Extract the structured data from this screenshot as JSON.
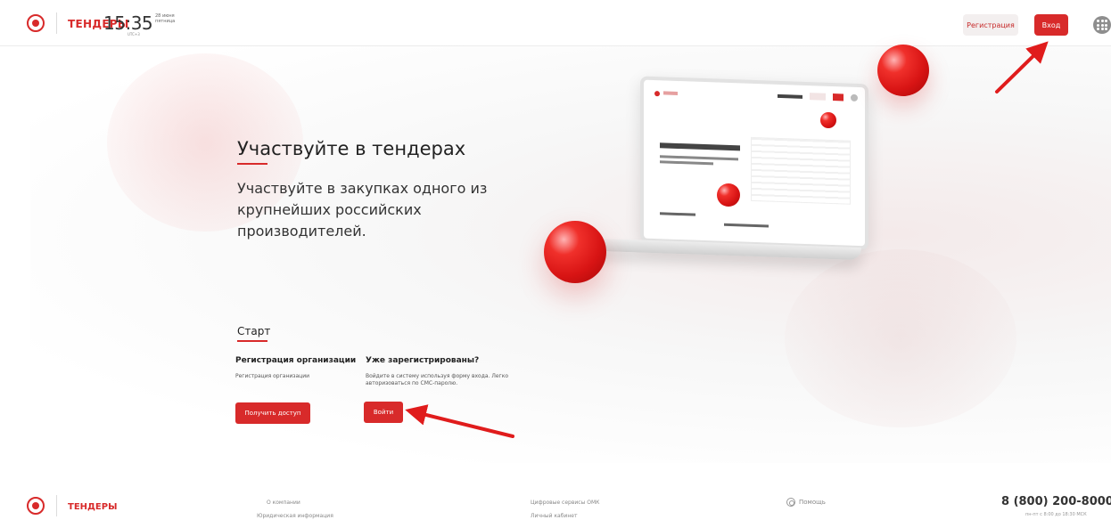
{
  "header": {
    "brand": "ТЕНДЕРЫ",
    "time": "15:35",
    "date_line1": "28 июня",
    "date_line2": "пятница",
    "timezone": "UTC+3",
    "register_label": "Регистрация",
    "login_label": "Вход"
  },
  "hero": {
    "title": "Участвуйте в тендерах",
    "subtitle": "Участвуйте в закупках одного из крупнейших российских производителей."
  },
  "start": {
    "title": "Старт",
    "org_heading": "Регистрация организации",
    "org_text": "Регистрация организации",
    "org_button": "Получить доступ",
    "reg_heading": "Уже зарегистрированы?",
    "reg_text": "Войдите в систему используя форму входа. Легко авторизоваться по СМС-паролю.",
    "reg_button": "Войти"
  },
  "footer": {
    "brand": "ТЕНДЕРЫ",
    "link_about": "О компании",
    "link_legal": "Юридическая информация",
    "link_digital": "Цифровые сервисы ОМК",
    "link_cabinet": "Личный кабинет",
    "help": "Помощь",
    "phone": "8 (800) 200-8000",
    "hours": "пн-пт с 8:00 до 18:30 МСК"
  },
  "colors": {
    "accent": "#d82a2a",
    "register_bg": "#f3efef"
  }
}
